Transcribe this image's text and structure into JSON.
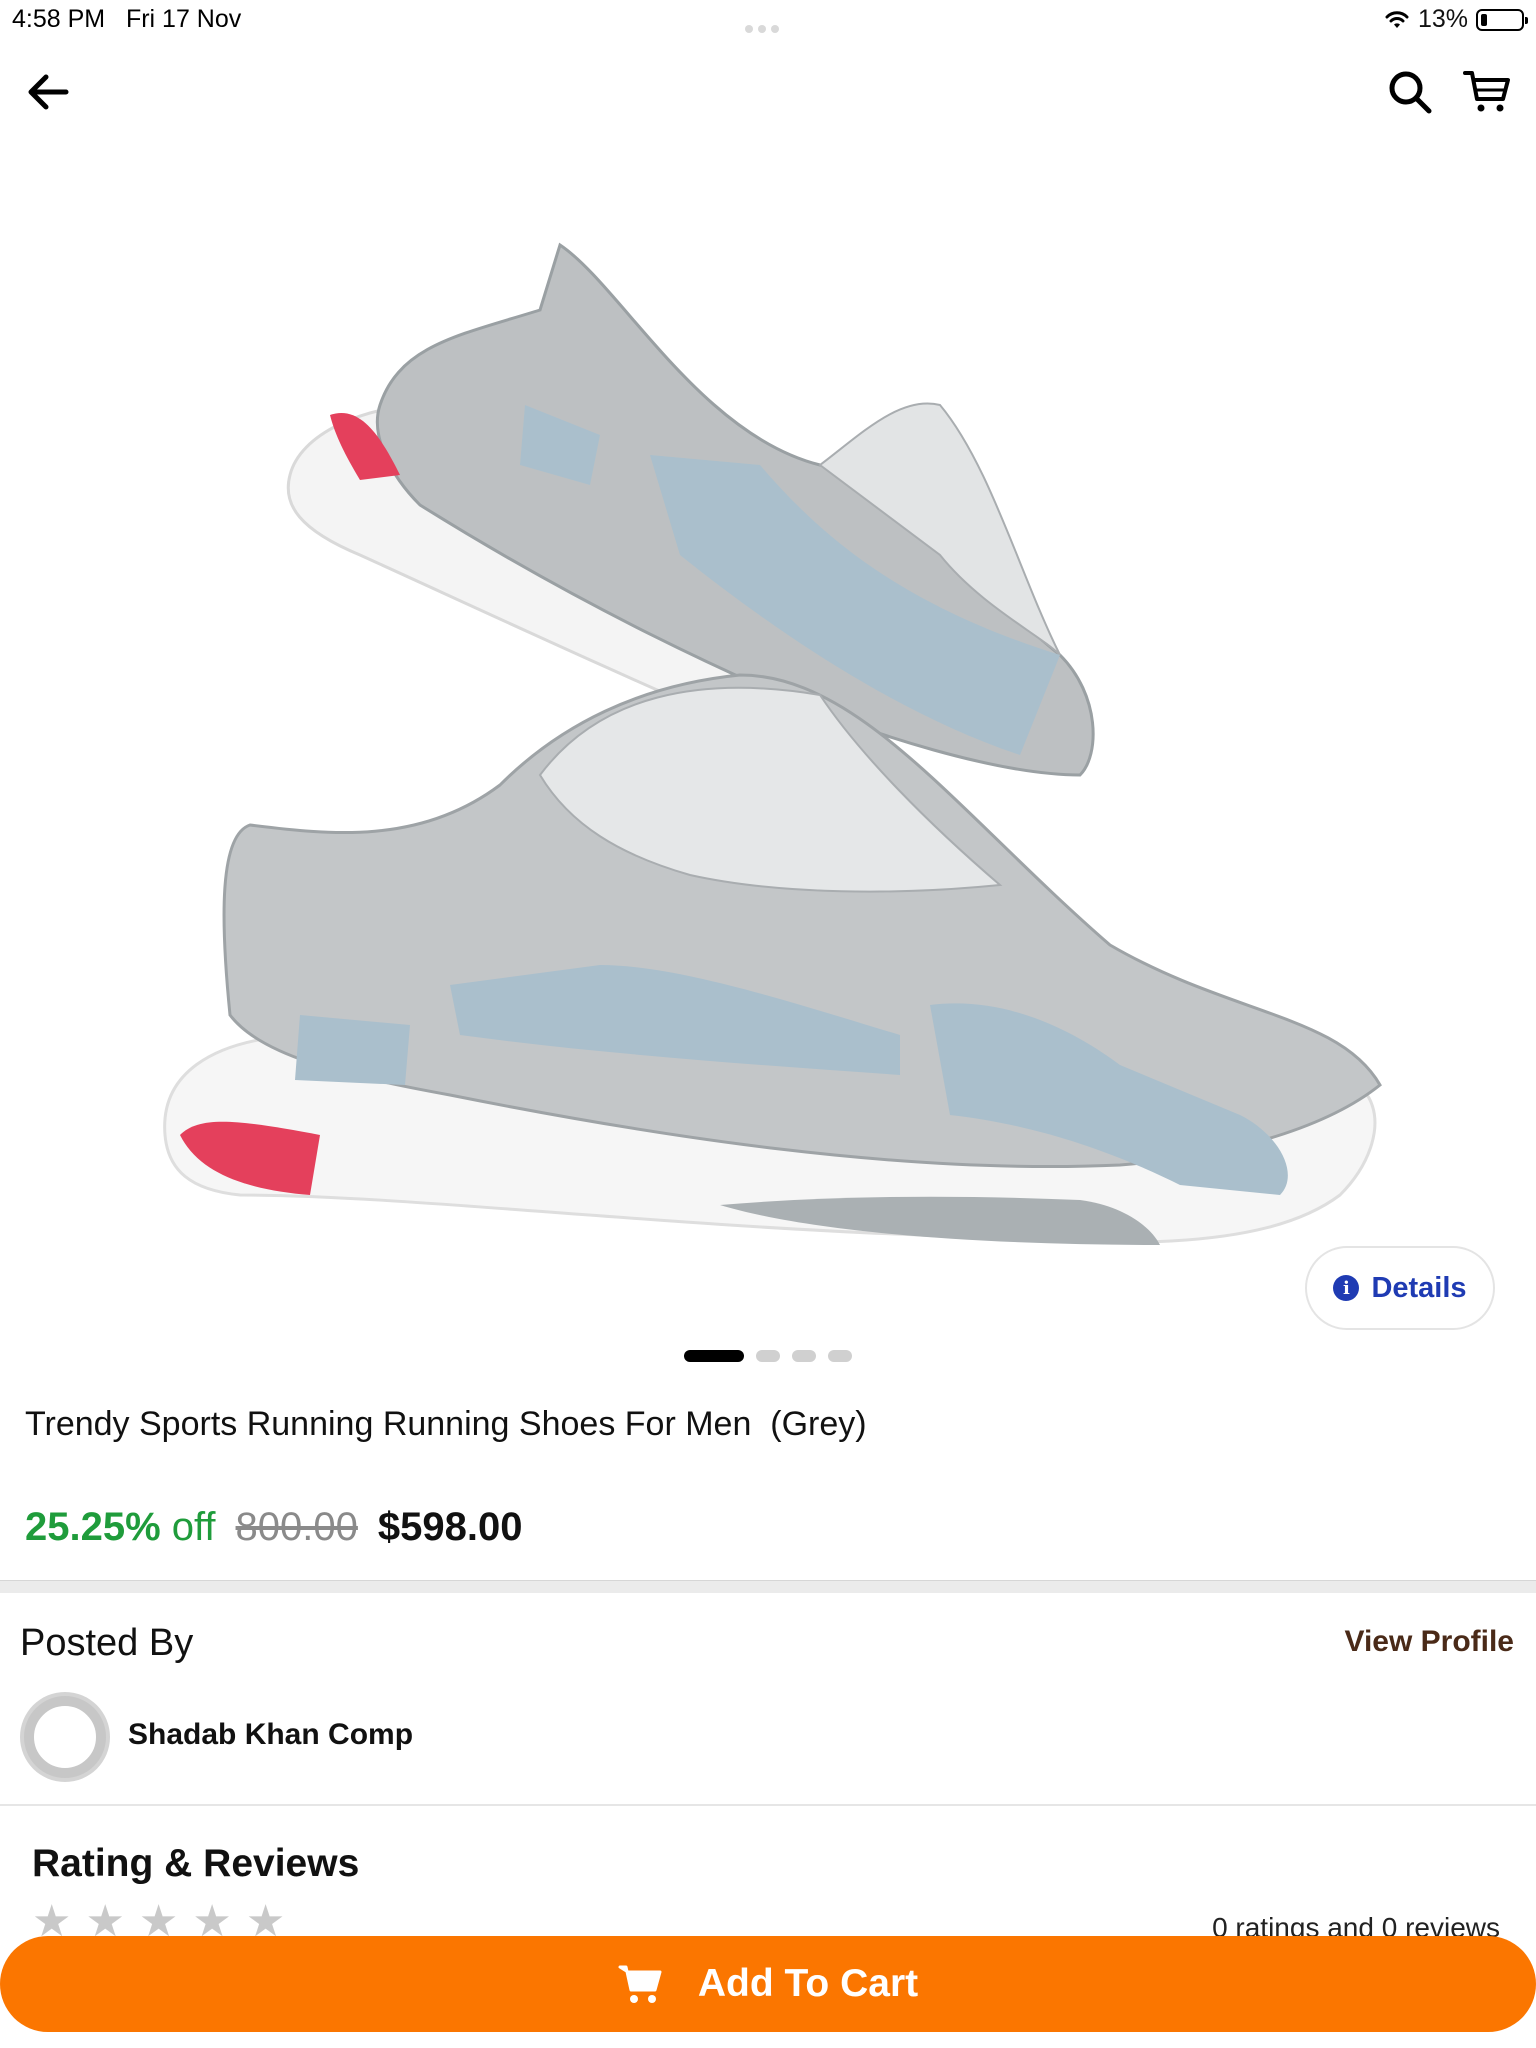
{
  "status_bar": {
    "time": "4:58 PM",
    "date": "Fri 17 Nov",
    "battery": "13%"
  },
  "nav": {
    "back_icon": "arrow-left-icon",
    "search_icon": "search-icon",
    "cart_icon": "cart-icon"
  },
  "gallery": {
    "details_label": "Details",
    "image_count": 4,
    "active_index": 0
  },
  "product": {
    "title": "Trendy Sports Running Running Shoes For Men  (Grey)",
    "discount": "25.25%",
    "off_label": "off",
    "mrp": "800.00",
    "price": "$598.00"
  },
  "posted": {
    "heading": "Posted By",
    "view_profile": "View Profile",
    "seller_name": "Shadab Khan Comp"
  },
  "reviews": {
    "heading": "Rating & Reviews",
    "stars": 0,
    "summary": "0 ratings and 0 reviews"
  },
  "cta": {
    "add_to_cart": "Add To Cart"
  },
  "colors": {
    "accent": "#fb7600",
    "discount": "#1f9c3b",
    "link": "#1f3bb3",
    "profile": "#4a2a18"
  }
}
